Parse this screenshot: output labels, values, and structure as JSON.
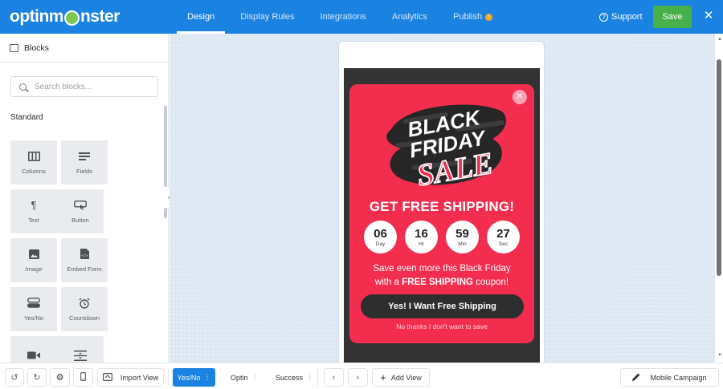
{
  "app": {
    "logo_text_1": "optinm",
    "logo_text_2": "nster"
  },
  "nav": {
    "tabs": [
      {
        "label": "Design",
        "active": true
      },
      {
        "label": "Display Rules",
        "active": false
      },
      {
        "label": "Integrations",
        "active": false
      },
      {
        "label": "Analytics",
        "active": false
      },
      {
        "label": "Publish",
        "active": false
      }
    ],
    "support": "Support",
    "save": "Save",
    "close_icon": "close-icon"
  },
  "sidebar": {
    "title": "Blocks",
    "search_placeholder": "Search blocks...",
    "section": "Standard",
    "blocks": [
      {
        "label": "Columns",
        "icon": "columns-icon"
      },
      {
        "label": "Fields",
        "icon": "fields-icon"
      },
      {
        "label": "Text",
        "icon": "paragraph-icon"
      },
      {
        "label": "Button",
        "icon": "button-icon"
      },
      {
        "label": "Image",
        "icon": "image-icon"
      },
      {
        "label": "Embed Form",
        "icon": "embed-form-icon"
      },
      {
        "label": "Yes/No",
        "icon": "yes-no-icon"
      },
      {
        "label": "Countdown",
        "icon": "alarm-clock-icon"
      },
      {
        "label": "",
        "icon": "video-icon"
      },
      {
        "label": "",
        "icon": "divider-icon"
      }
    ]
  },
  "popup": {
    "art": {
      "line1": "BLACK",
      "line2": "FRIDAY",
      "line3": "SALE"
    },
    "headline": "GET FREE SHIPPING!",
    "countdown": [
      {
        "value": "06",
        "unit": "Day"
      },
      {
        "value": "16",
        "unit": "Hr"
      },
      {
        "value": "59",
        "unit": "Min"
      },
      {
        "value": "27",
        "unit": "Sec"
      }
    ],
    "sub_line1": "Save even more this Black Friday",
    "sub_line2_pre": "with a ",
    "sub_line2_bold": "FREE SHIPPING",
    "sub_line2_post": " coupon!",
    "cta": "Yes! I Want Free Shipping",
    "decline": "No thanks I don't want to save"
  },
  "bottombar": {
    "import_view": "Import View",
    "views": [
      {
        "label": "Yes/No",
        "active": true
      },
      {
        "label": "Optin",
        "active": false
      },
      {
        "label": "Success",
        "active": false
      }
    ],
    "add_view": "Add View",
    "campaign": "Mobile Campaign"
  },
  "colors": {
    "brand": "#1a82e0",
    "save": "#47b04b",
    "popup_bg": "#f22d4e"
  }
}
